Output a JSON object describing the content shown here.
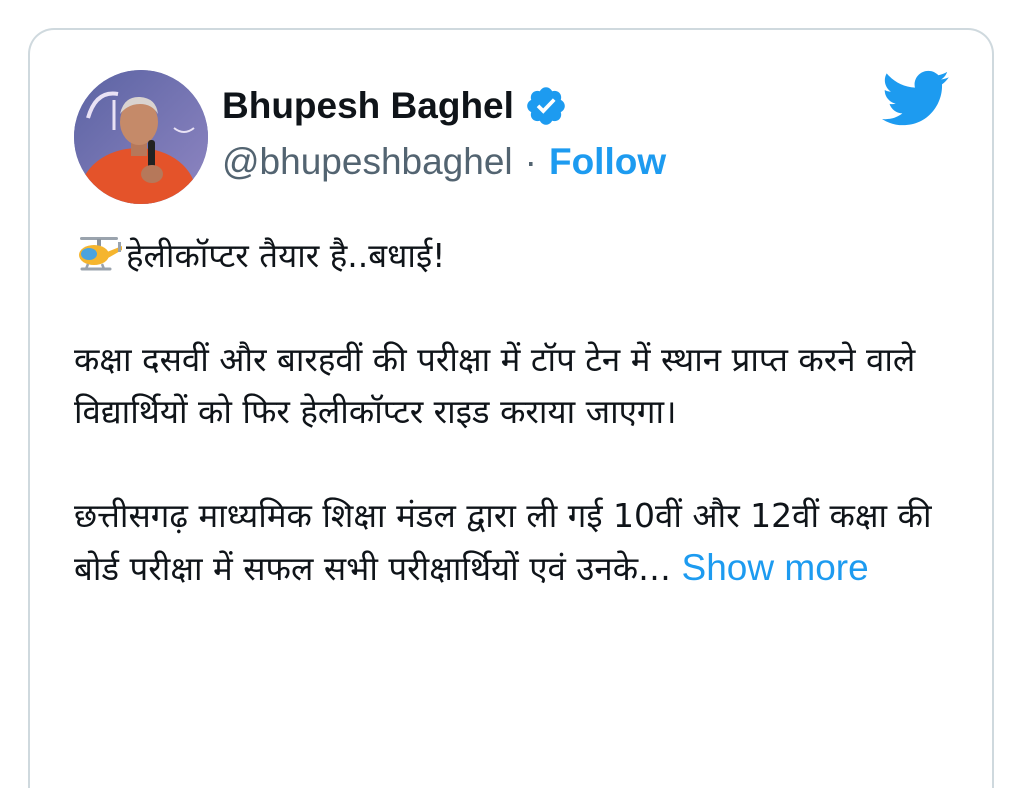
{
  "tweet": {
    "author": {
      "display_name": "Bhupesh Baghel",
      "handle": "@bhupeshbaghel",
      "separator": "·",
      "follow_label": "Follow",
      "verified": true
    },
    "icons": {
      "logo": "twitter-bird-icon",
      "verified": "verified-badge-icon",
      "leading_emoji": "helicopter-icon"
    },
    "text": {
      "line1": "हेलीकॉप्टर तैयार है..बधाई!",
      "para2": "कक्षा दसवीं और बारहवीं की परीक्षा में टॉप टेन में स्थान प्राप्त करने वाले विद्यार्थियों को फिर हेलीकॉप्टर राइड कराया जाएगा।",
      "para3": "छत्तीसगढ़ माध्यमिक शिक्षा मंडल द्वारा ली गई 10वीं और 12वीं कक्षा की बोर्ड परीक्षा में सफल सभी परीक्षार्थियों एवं उनके…",
      "show_more": "Show more"
    }
  },
  "colors": {
    "accent": "#1d9bf0",
    "text_primary": "#0f1419",
    "text_secondary": "#536471",
    "border": "#cfd9de"
  }
}
